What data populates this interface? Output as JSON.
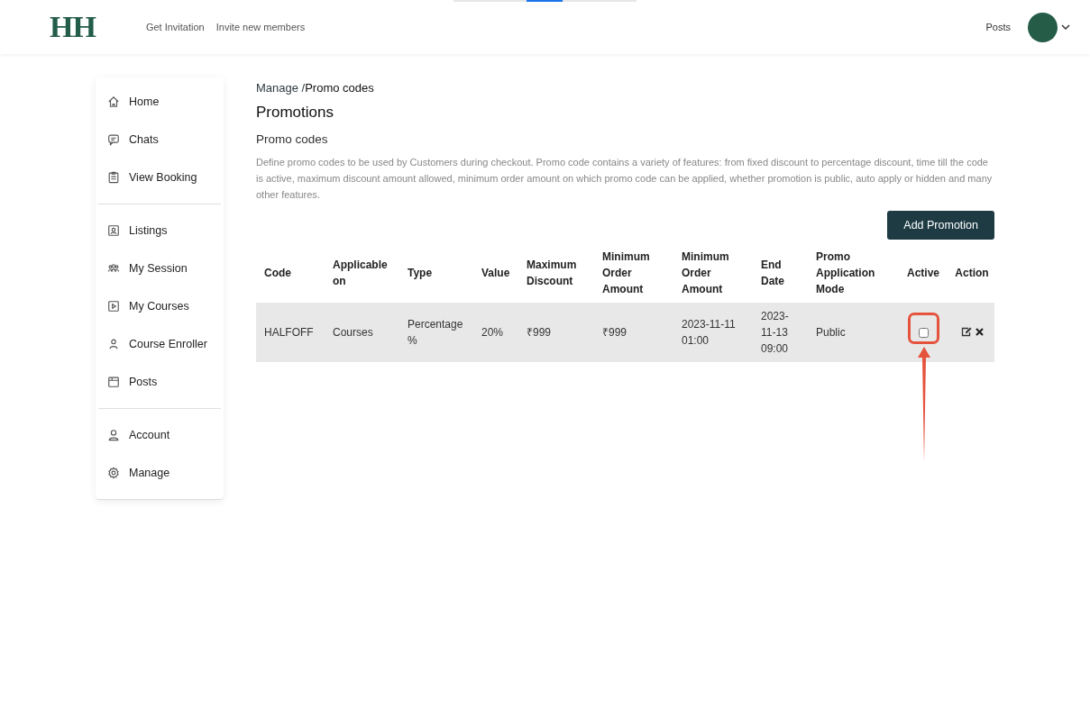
{
  "header": {
    "logo": "HH",
    "nav": [
      "Get Invitation",
      "Invite new members"
    ],
    "right_link": "Posts"
  },
  "sidebar": {
    "groups": [
      [
        "Home",
        "Chats",
        "View Booking"
      ],
      [
        "Listings",
        "My Session",
        "My Courses",
        "Course Enroller",
        "Posts"
      ],
      [
        "Account",
        "Manage"
      ]
    ]
  },
  "breadcrumb": {
    "parent": "Manage /",
    "current": "Promo codes"
  },
  "title": "Promotions",
  "subtitle": "Promo codes",
  "description": "Define promo codes to be used by Customers during checkout. Promo code contains a variety of features: from fixed discount to percentage discount, time till the code is active, maximum discount amount allowed, minimum order amount on which promo code can be applied, whether promotion is public, auto apply or hidden and many other features.",
  "add_button": "Add Promotion",
  "table": {
    "columns": [
      "Code",
      "Applicable on",
      "Type",
      "Value",
      "Maximum Discount",
      "Minimum Order Amount",
      "Minimum Order Amount",
      "End Date",
      "Promo Application Mode",
      "Active",
      "Action"
    ],
    "rows": [
      {
        "cells": [
          "HALFOFF",
          "Courses",
          "Percentage %",
          "20%",
          "₹999",
          "₹999",
          "2023-11-11 01:00",
          "2023-11-13 09:00",
          "Public"
        ],
        "active": false
      }
    ]
  }
}
